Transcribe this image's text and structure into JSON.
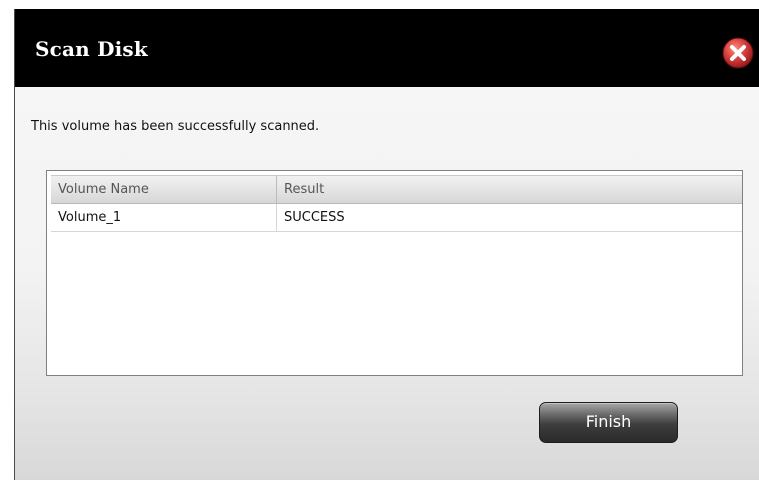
{
  "dialog": {
    "title": "Scan Disk",
    "close_icon": "close-x-icon",
    "message": "This volume has been successfully scanned.",
    "table": {
      "columns": [
        "Volume Name",
        "Result"
      ],
      "rows": [
        [
          "Volume_1",
          "SUCCESS"
        ]
      ]
    },
    "finish_label": "Finish"
  },
  "colors": {
    "titlebar": "#000000",
    "close_button": "#d23a3a",
    "button": "#2a2a2a"
  }
}
